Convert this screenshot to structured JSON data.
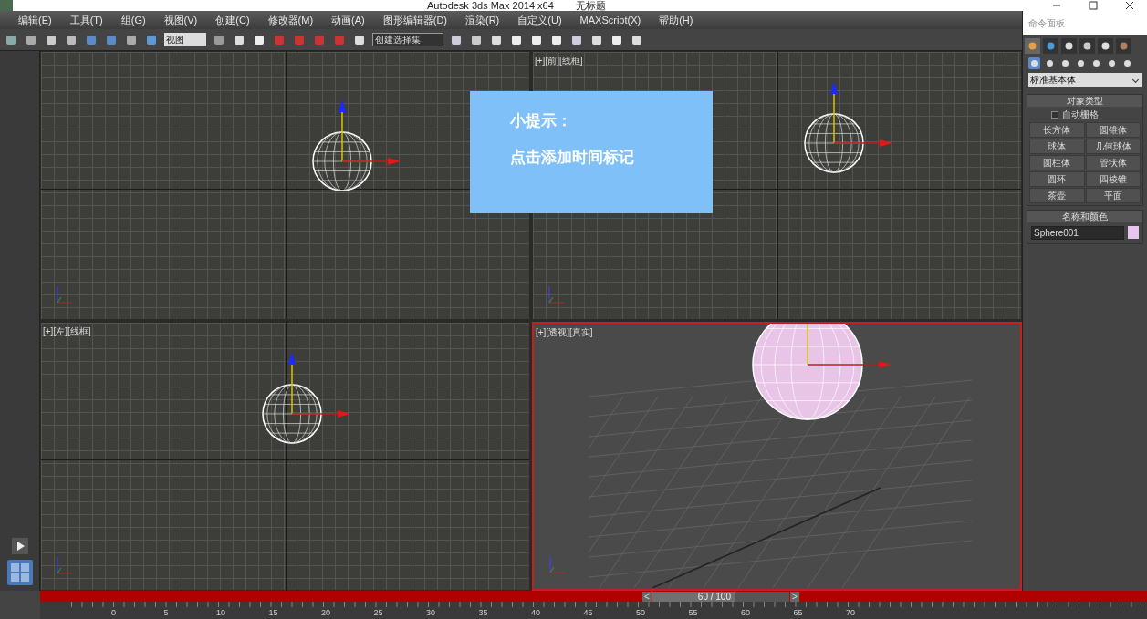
{
  "window": {
    "title": "Autodesk 3ds Max  2014 x64",
    "document": "无标题"
  },
  "menu": [
    "编辑(E)",
    "工具(T)",
    "组(G)",
    "视图(V)",
    "创建(C)",
    "修改器(M)",
    "动画(A)",
    "图形编辑器(D)",
    "渲染(R)",
    "自定义(U)",
    "MAXScript(X)",
    "帮助(H)"
  ],
  "toolbar": {
    "coordinate_dropdown": "视图",
    "selection_set_dropdown": "创建选择集"
  },
  "viewports": [
    {
      "active": false,
      "kind": "ortho"
    },
    {
      "label": "[+][前][线框]",
      "active": false,
      "kind": "ortho"
    },
    {
      "label": "[+][左][线框]",
      "active": false,
      "kind": "ortho"
    },
    {
      "label": "[+][透视][真实]",
      "active": true,
      "kind": "perspective"
    }
  ],
  "tip": {
    "title": "小提示：",
    "text": "点击添加时间标记"
  },
  "command_panel": {
    "title": "命令面板",
    "tabs": [
      {
        "selected": true
      },
      {
        "selected": false
      },
      {
        "selected": false
      },
      {
        "selected": false
      },
      {
        "selected": false
      },
      {
        "selected": false
      }
    ],
    "categories": [
      {
        "selected": true
      },
      {
        "selected": false
      },
      {
        "selected": false
      },
      {
        "selected": false
      },
      {
        "selected": false
      },
      {
        "selected": false
      },
      {
        "selected": false
      }
    ],
    "dropdown": "标准基本体",
    "object_type": {
      "title": "对象类型",
      "autogrid": {
        "label": "自动栅格",
        "checked": false
      },
      "buttons": [
        "长方体",
        "圆锥体",
        "球体",
        "几何球体",
        "圆柱体",
        "管状体",
        "圆环",
        "四棱锥",
        "茶壶",
        "平面"
      ]
    },
    "name_color": {
      "title": "名称和颜色",
      "name": "Sphere001",
      "color": "#e6c6ec"
    }
  },
  "time_slider": {
    "reading": "60 / 100",
    "prev": "<",
    "next": ">",
    "level": 0.6
  },
  "ruler": {
    "ticks": [
      "0",
      "5",
      "10",
      "15",
      "20",
      "25",
      "30",
      "35",
      "40",
      "45",
      "50",
      "55",
      "60",
      "65",
      "70"
    ]
  }
}
